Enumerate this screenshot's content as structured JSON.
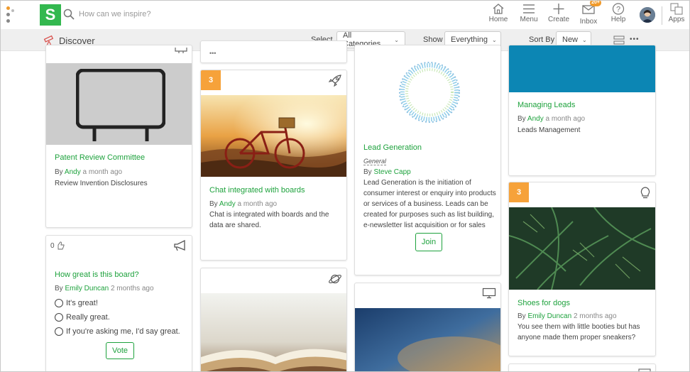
{
  "header": {
    "logo": "S",
    "search_placeholder": "How can we inspire?",
    "nav": {
      "home": "Home",
      "menu": "Menu",
      "create": "Create",
      "inbox": "Inbox",
      "inbox_badge": "20+",
      "help": "Help",
      "apps": "Apps"
    }
  },
  "filterbar": {
    "title": "Discover",
    "select_label": "Select",
    "category_value": "All Categories",
    "show_label": "Show",
    "show_value": "Everything",
    "sort_label": "Sort By",
    "sort_value": "New",
    "more": "•••"
  },
  "cards": {
    "patent": {
      "title": "Patent Review Committee",
      "by": "By",
      "author": "Andy",
      "time": "a month ago",
      "desc": "Review Invention Disclosures"
    },
    "poll": {
      "count": "0",
      "title": "How great is this board?",
      "by": "By",
      "author": "Emily Duncan",
      "time": "2 months ago",
      "options": [
        "It's great!",
        "Really great.",
        "If you're asking me, I'd say great."
      ],
      "vote": "Vote"
    },
    "chat": {
      "num": "3",
      "title": "Chat integrated with boards",
      "by": "By",
      "author": "Andy",
      "time": "a month ago",
      "desc": "Chat is integrated with boards and the data are shared."
    },
    "lead": {
      "title": "Lead Generation",
      "category": "General",
      "by": "By",
      "author": "Steve Capp",
      "desc": "Lead Generation is the initiation of consumer interest or enquiry into products or services of a business. Leads can be created for purposes such as list building, e-newsletter list acquisition or for sales",
      "join": "Join"
    },
    "leads": {
      "title": "Managing Leads",
      "by": "By",
      "author": "Andy",
      "time": "a month ago",
      "desc": "Leads Management"
    },
    "shoes": {
      "num": "3",
      "title": "Shoes for dogs",
      "by": "By",
      "author": "Emily Duncan",
      "time": "2 months ago",
      "desc": "You see them with little booties but has anyone made them proper sneakers?"
    }
  },
  "colors": {
    "brand": "#33b84f",
    "link": "#1ea23d",
    "badge": "#f6a23a",
    "teal": "#0c86b4"
  }
}
